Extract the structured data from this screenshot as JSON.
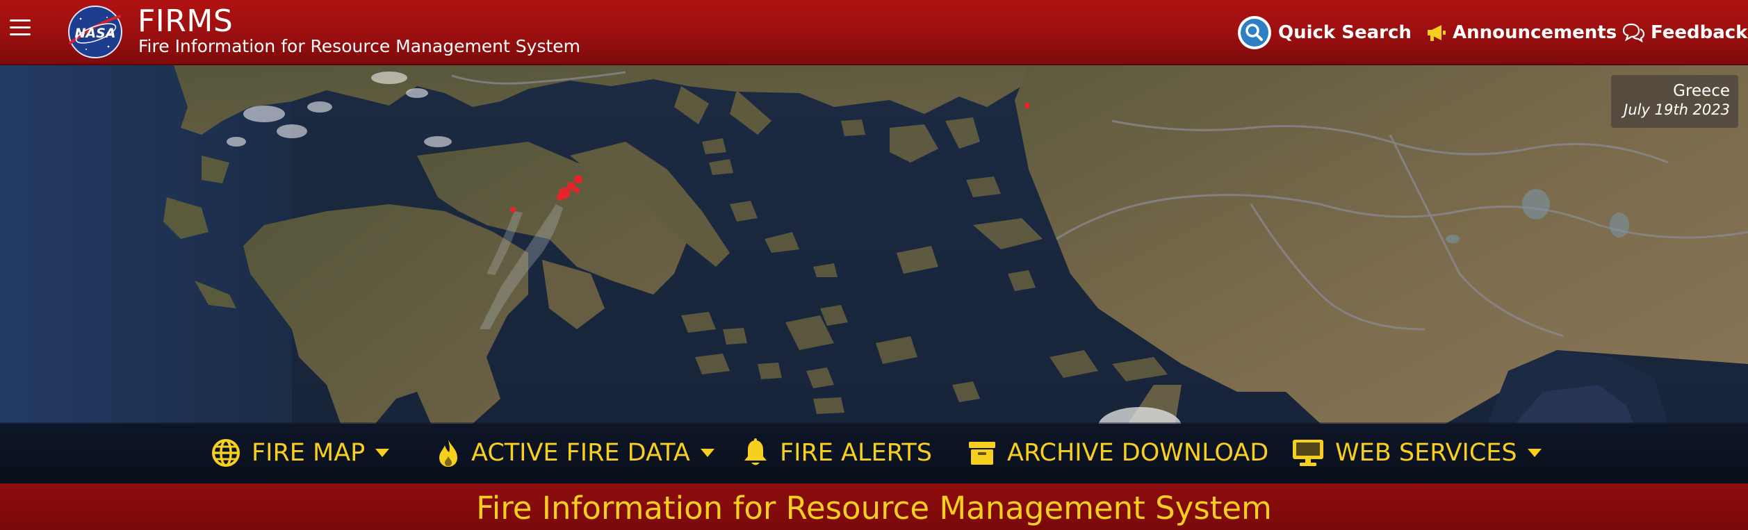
{
  "header": {
    "app_name": "FIRMS",
    "app_subtitle": "Fire Information for Resource Management System",
    "logo_text": "NASA",
    "links": {
      "quick_search": "Quick Search",
      "announcements": "Announcements",
      "feedback": "Feedback"
    }
  },
  "banner": {
    "location": "Greece",
    "date": "July 19th 2023"
  },
  "nav": {
    "fire_map": "FIRE MAP",
    "active_fire_data": "ACTIVE FIRE DATA",
    "fire_alerts": "FIRE ALERTS",
    "archive_download": "ARCHIVE DOWNLOAD",
    "web_services": "WEB SERVICES"
  },
  "footer": {
    "title": "Fire Information for Resource Management System"
  },
  "colors": {
    "header_red": "#9a0f0f",
    "nav_yellow": "#f7cf1e",
    "sea": "#152237",
    "land": "#6e6248",
    "fire_hotspot": "#e8232a"
  },
  "icons": [
    "menu-icon",
    "nasa-logo",
    "search-icon",
    "megaphone-icon",
    "feedback-chat-icon",
    "globe-icon",
    "flame-icon",
    "bell-icon",
    "archive-box-icon",
    "monitor-icon",
    "caret-down-icon"
  ]
}
